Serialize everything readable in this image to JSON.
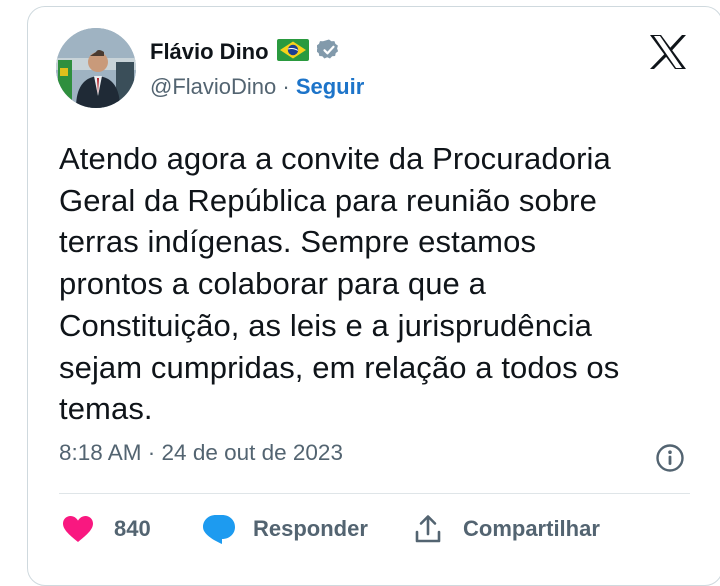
{
  "author": {
    "display_name": "Flávio Dino",
    "flag_emoji": "🇧🇷",
    "verified": true,
    "handle": "@FlavioDino",
    "separator": " · ",
    "follow_label": "Seguir"
  },
  "platform_logo": "x-logo-icon",
  "tweet": {
    "lines": [
      "Atendo agora a convite da Procuradoria",
      "Geral da República para reunião sobre",
      "terras indígenas. Sempre estamos",
      "prontos a colaborar para que a",
      "Constituição, as leis e a jurisprudência",
      "sejam cumpridas, em relação a todos os",
      "temas."
    ]
  },
  "meta": {
    "timestamp": "8:18 AM · 24 de out de 2023"
  },
  "actions": {
    "like_count": "840",
    "reply_label": "Responder",
    "share_label": "Compartilhar"
  },
  "colors": {
    "like": "#f91880",
    "reply": "#1d9bf0",
    "link": "#1d74c9",
    "text": "#0f1419",
    "muted": "#536471",
    "verified_badge": "#829aab"
  }
}
